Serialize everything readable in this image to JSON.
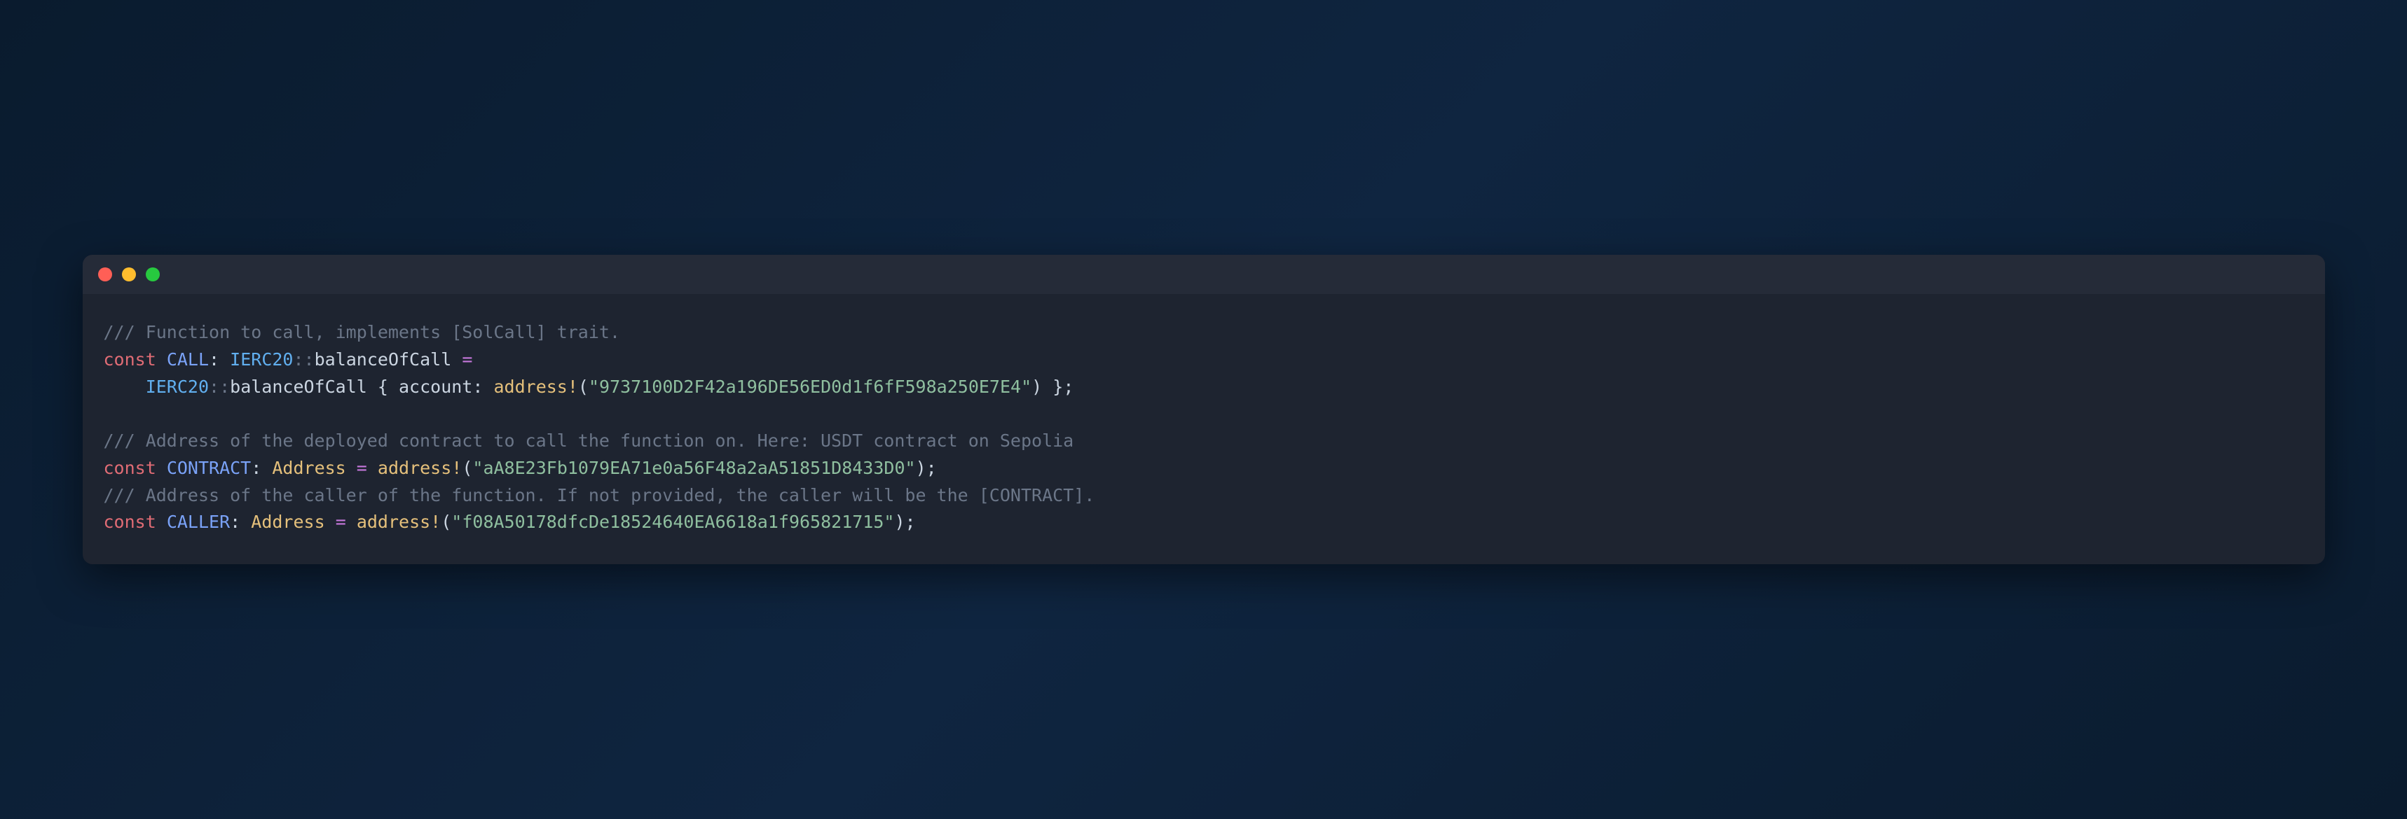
{
  "code": {
    "comment1": "/// Function to call, implements [SolCall] trait.",
    "kw_const": "const",
    "call_name": "CALL",
    "ierc20": "IERC20",
    "dcolon": "::",
    "balanceOfCall": "balanceOfCall",
    "eq": "=",
    "lbrace": "{",
    "rbrace": "}",
    "account_field": "account",
    "colon": ":",
    "address_macro": "address!",
    "lparen": "(",
    "rparen": ")",
    "semicolon": ";",
    "account_addr": "\"9737100D2F42a196DE56ED0d1f6fF598a250E7E4\"",
    "comment2": "/// Address of the deployed contract to call the function on. Here: USDT contract on Sepolia",
    "contract_name": "CONTRACT",
    "address_type": "Address",
    "contract_addr": "\"aA8E23Fb1079EA71e0a56F48a2aA51851D8433D0\"",
    "comment3": "/// Address of the caller of the function. If not provided, the caller will be the [CONTRACT].",
    "caller_name": "CALLER",
    "caller_addr": "\"f08A50178dfcDe18524640EA6618a1f965821715\""
  },
  "colors": {
    "red": "#ff5f56",
    "yellow": "#ffbd2e",
    "green": "#27c93f"
  }
}
